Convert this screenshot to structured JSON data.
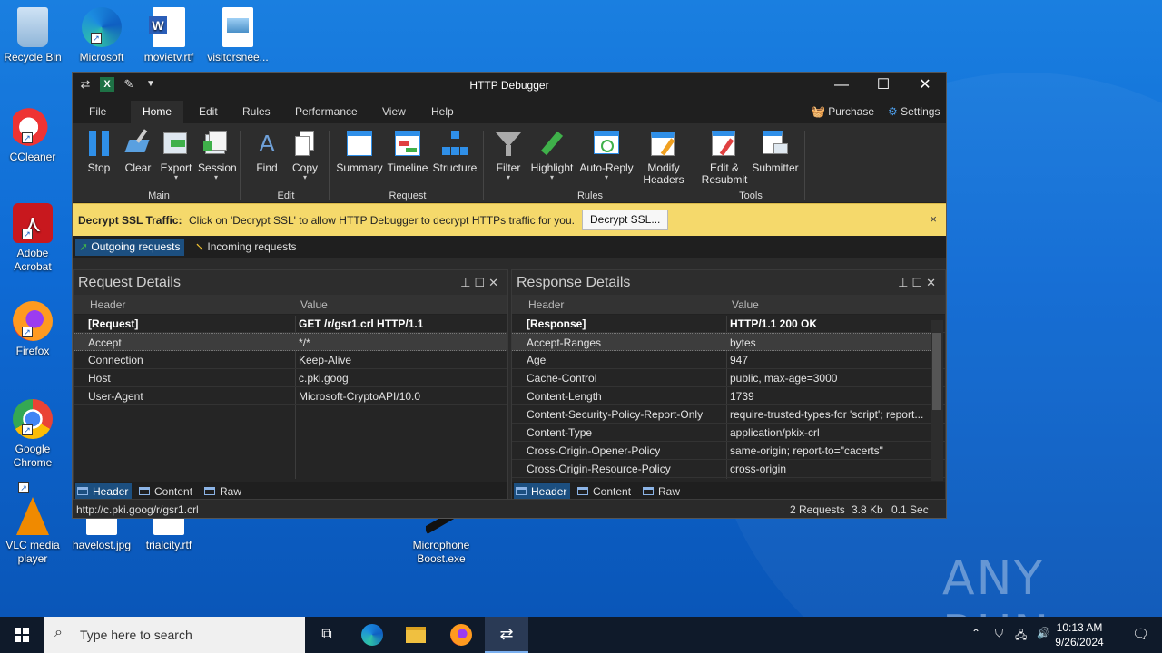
{
  "desktop": {
    "icons": [
      {
        "label": "Recycle Bin"
      },
      {
        "label": "Microsoft Edge"
      },
      {
        "label": "movietv.rtf"
      },
      {
        "label": "visitorsnee..."
      },
      {
        "label": "CCleaner"
      },
      {
        "label": "Adobe Acrobat"
      },
      {
        "label": "Firefox"
      },
      {
        "label": "Google Chrome"
      },
      {
        "label": "VLC media player"
      },
      {
        "label": "havelost.jpg"
      },
      {
        "label": "trialcity.rtf"
      },
      {
        "label": "Microphone Boost.exe"
      }
    ],
    "watermark": "ANY RUN"
  },
  "window": {
    "title": "HTTP Debugger",
    "menu": [
      "File",
      "Home",
      "Edit",
      "Rules",
      "Performance",
      "View",
      "Help"
    ],
    "purchase": "Purchase",
    "settings": "Settings",
    "ribbon": {
      "buttons": [
        "Stop",
        "Clear",
        "Export",
        "Session",
        "Find",
        "Copy",
        "Summary",
        "Timeline",
        "Structure",
        "Filter",
        "Highlight",
        "Auto-Reply",
        "Modify Headers",
        "Edit & Resubmit",
        "Submitter"
      ],
      "groups": [
        "Main",
        "Edit",
        "Request",
        "Rules",
        "Tools"
      ]
    },
    "ssl": {
      "label": "Decrypt SSL Traffic:",
      "text": "Click on 'Decrypt SSL' to allow HTTP Debugger to decrypt HTTPs traffic for you.",
      "button": "Decrypt SSL...",
      "close": "×"
    },
    "tabs": [
      "Outgoing requests",
      "Incoming requests"
    ],
    "request": {
      "title": "Request Details",
      "col_header": "Header",
      "col_value": "Value",
      "rows": [
        {
          "h": "[Request]",
          "v": "GET /r/gsr1.crl HTTP/1.1"
        },
        {
          "h": "Accept",
          "v": "*/*"
        },
        {
          "h": "Connection",
          "v": "Keep-Alive"
        },
        {
          "h": "Host",
          "v": "c.pki.goog"
        },
        {
          "h": "User-Agent",
          "v": "Microsoft-CryptoAPI/10.0"
        }
      ],
      "bottom_tabs": [
        "Header",
        "Content",
        "Raw"
      ]
    },
    "response": {
      "title": "Response Details",
      "col_header": "Header",
      "col_value": "Value",
      "rows": [
        {
          "h": "[Response]",
          "v": "HTTP/1.1 200 OK"
        },
        {
          "h": "Accept-Ranges",
          "v": "bytes"
        },
        {
          "h": "Age",
          "v": "947"
        },
        {
          "h": "Cache-Control",
          "v": "public, max-age=3000"
        },
        {
          "h": "Content-Length",
          "v": "1739"
        },
        {
          "h": "Content-Security-Policy-Report-Only",
          "v": "require-trusted-types-for 'script'; report..."
        },
        {
          "h": "Content-Type",
          "v": "application/pkix-crl"
        },
        {
          "h": "Cross-Origin-Opener-Policy",
          "v": "same-origin; report-to=\"cacerts\""
        },
        {
          "h": "Cross-Origin-Resource-Policy",
          "v": "cross-origin"
        }
      ],
      "bottom_tabs": [
        "Header",
        "Content",
        "Raw"
      ]
    },
    "status": {
      "url": "http://c.pki.goog/r/gsr1.crl",
      "requests": "2 Requests",
      "size": "3.8 Kb",
      "time": "0.1 Sec"
    }
  },
  "taskbar": {
    "search_placeholder": "Type here to search",
    "time": "10:13 AM",
    "date": "9/26/2024"
  }
}
